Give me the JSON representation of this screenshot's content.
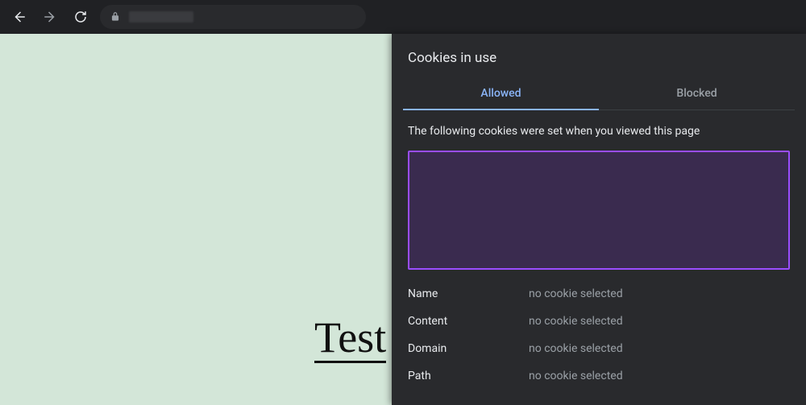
{
  "page": {
    "heading_visible": "Test"
  },
  "panel": {
    "title": "Cookies in use",
    "tabs": {
      "allowed": "Allowed",
      "blocked": "Blocked"
    },
    "description": "The following cookies were set when you viewed this page",
    "details": {
      "name_label": "Name",
      "content_label": "Content",
      "domain_label": "Domain",
      "path_label": "Path",
      "empty_value": "no cookie selected"
    }
  }
}
